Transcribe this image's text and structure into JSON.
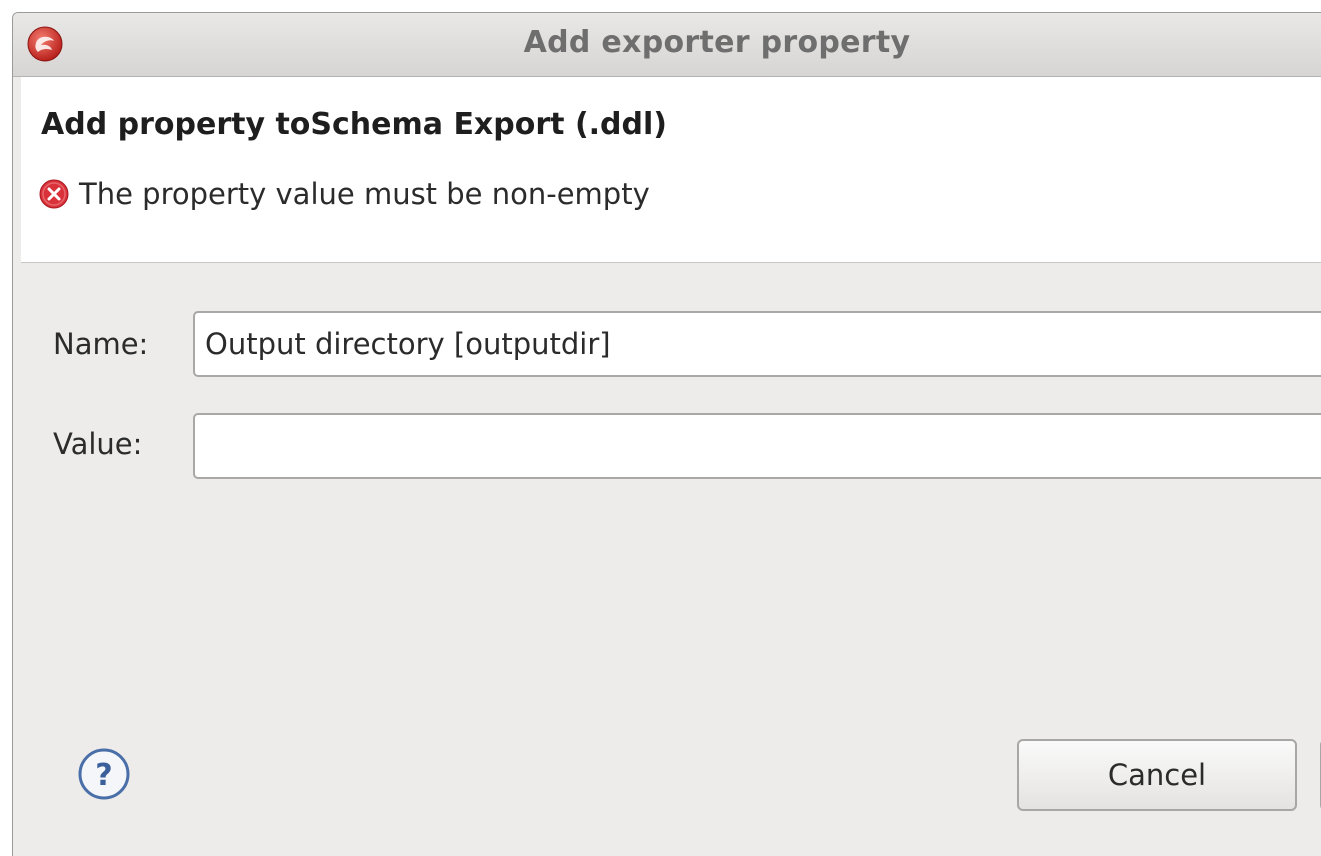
{
  "window": {
    "title": "Add exporter property",
    "app_icon": "eclipse-logo-icon"
  },
  "header": {
    "title": "Add property toSchema Export (.ddl)",
    "message": "The property value must be non-empty",
    "message_icon": "error-icon",
    "error_color": "#d9323a"
  },
  "form": {
    "name_label": "Name:",
    "name_value": "Output directory [outputdir]",
    "value_label": "Value:",
    "value_value": ""
  },
  "buttons": {
    "help_icon": "help-icon",
    "cancel_label": "Cancel"
  }
}
